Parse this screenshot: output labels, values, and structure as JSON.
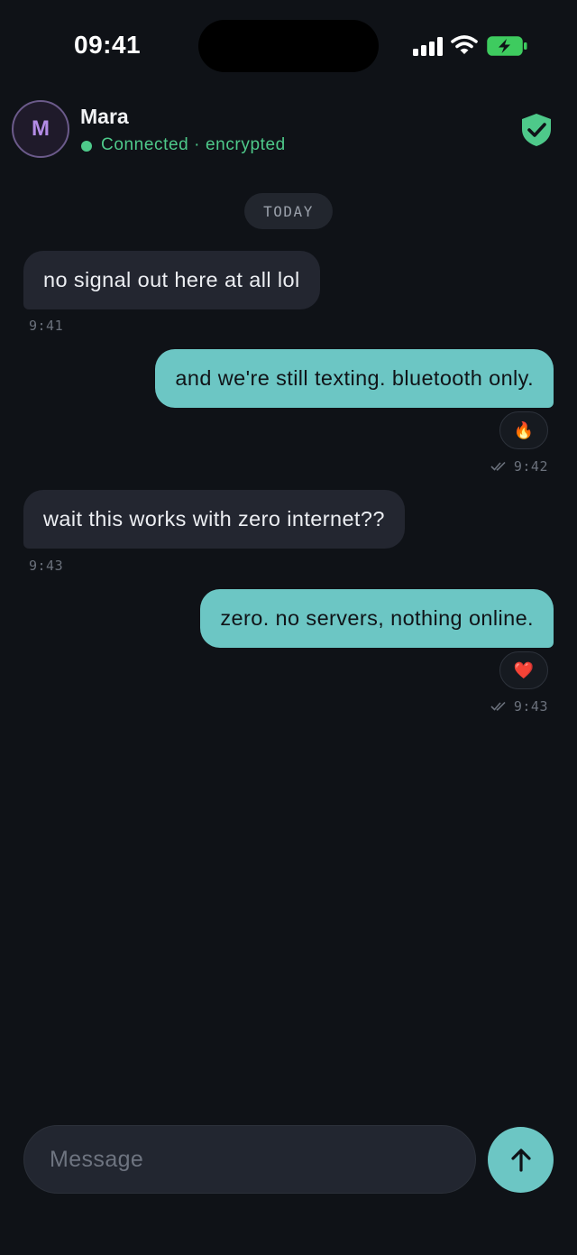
{
  "status_bar": {
    "time": "09:41",
    "icons": [
      "signal-icon",
      "wifi-icon",
      "battery-charging-icon"
    ]
  },
  "header": {
    "avatar_initial": "M",
    "name": "Mara",
    "status": "Connected · encrypted",
    "status_color": "#4ec98a",
    "verified_icon": "shield-check-icon"
  },
  "date_divider": "TODAY",
  "messages": [
    {
      "direction": "incoming",
      "text": "no signal out here at all lol",
      "time": "9:41"
    },
    {
      "direction": "outgoing",
      "text": "and we're still texting. bluetooth only.",
      "reaction": "🔥",
      "time": "9:42",
      "status_icon": "double-check-icon"
    },
    {
      "direction": "incoming",
      "text": "wait this works with zero internet??",
      "time": "9:43"
    },
    {
      "direction": "outgoing",
      "text": "zero. no servers, nothing online.",
      "reaction": "❤️",
      "time": "9:43",
      "status_icon": "double-check-icon"
    }
  ],
  "composer": {
    "placeholder": "Message",
    "value": "",
    "send_icon": "arrow-up-icon"
  },
  "colors": {
    "background": "#0f1217",
    "incoming_bubble": "#232630",
    "outgoing_bubble": "#6cc6c4",
    "accent": "#6cc6c4"
  }
}
